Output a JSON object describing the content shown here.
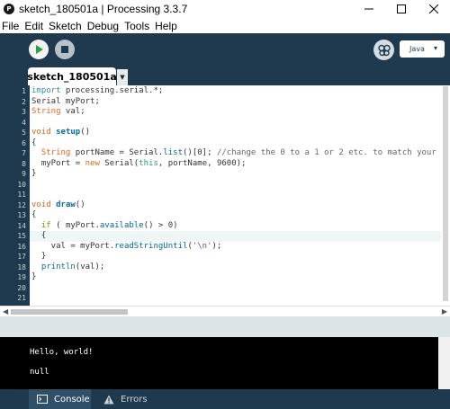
{
  "window": {
    "app_icon_letter": "P",
    "title": "sketch_180501a | Processing 3.3.7"
  },
  "menu": [
    "File",
    "Edit",
    "Sketch",
    "Debug",
    "Tools",
    "Help"
  ],
  "toolbar": {
    "mode_label": "Java"
  },
  "tab": {
    "name": "sketch_180501a"
  },
  "editor": {
    "line_numbers": [
      "1",
      "2",
      "3",
      "4",
      "5",
      "6",
      "7",
      "8",
      "9",
      "10",
      "11",
      "12",
      "13",
      "14",
      "15",
      "16",
      "17",
      "18",
      "19",
      "20",
      "21"
    ],
    "highlighted_line": 15,
    "lines": [
      "import processing.serial.*;",
      "Serial myPort;",
      "String val;",
      "",
      "void setup()",
      "{",
      "  String portName = Serial.list()[0]; //change the 0 to a 1 or 2 etc. to match your p",
      "  myPort = new Serial(this, portName, 9600);",
      "}",
      "",
      "",
      "void draw()",
      "{",
      "  if ( myPort.available() > 0)",
      "  {",
      "    val = myPort.readStringUntil('\\n');",
      "  }",
      "  println(val);",
      "}",
      "",
      ""
    ]
  },
  "console": {
    "lines": [
      "Hello, world!",
      "null"
    ]
  },
  "footer": {
    "console_label": "Console",
    "errors_label": "Errors"
  },
  "colors": {
    "toolbar_bg": "#1f3a4e",
    "keyword": "#e2661a",
    "function": "#0a6ba0",
    "comment": "#666666"
  }
}
